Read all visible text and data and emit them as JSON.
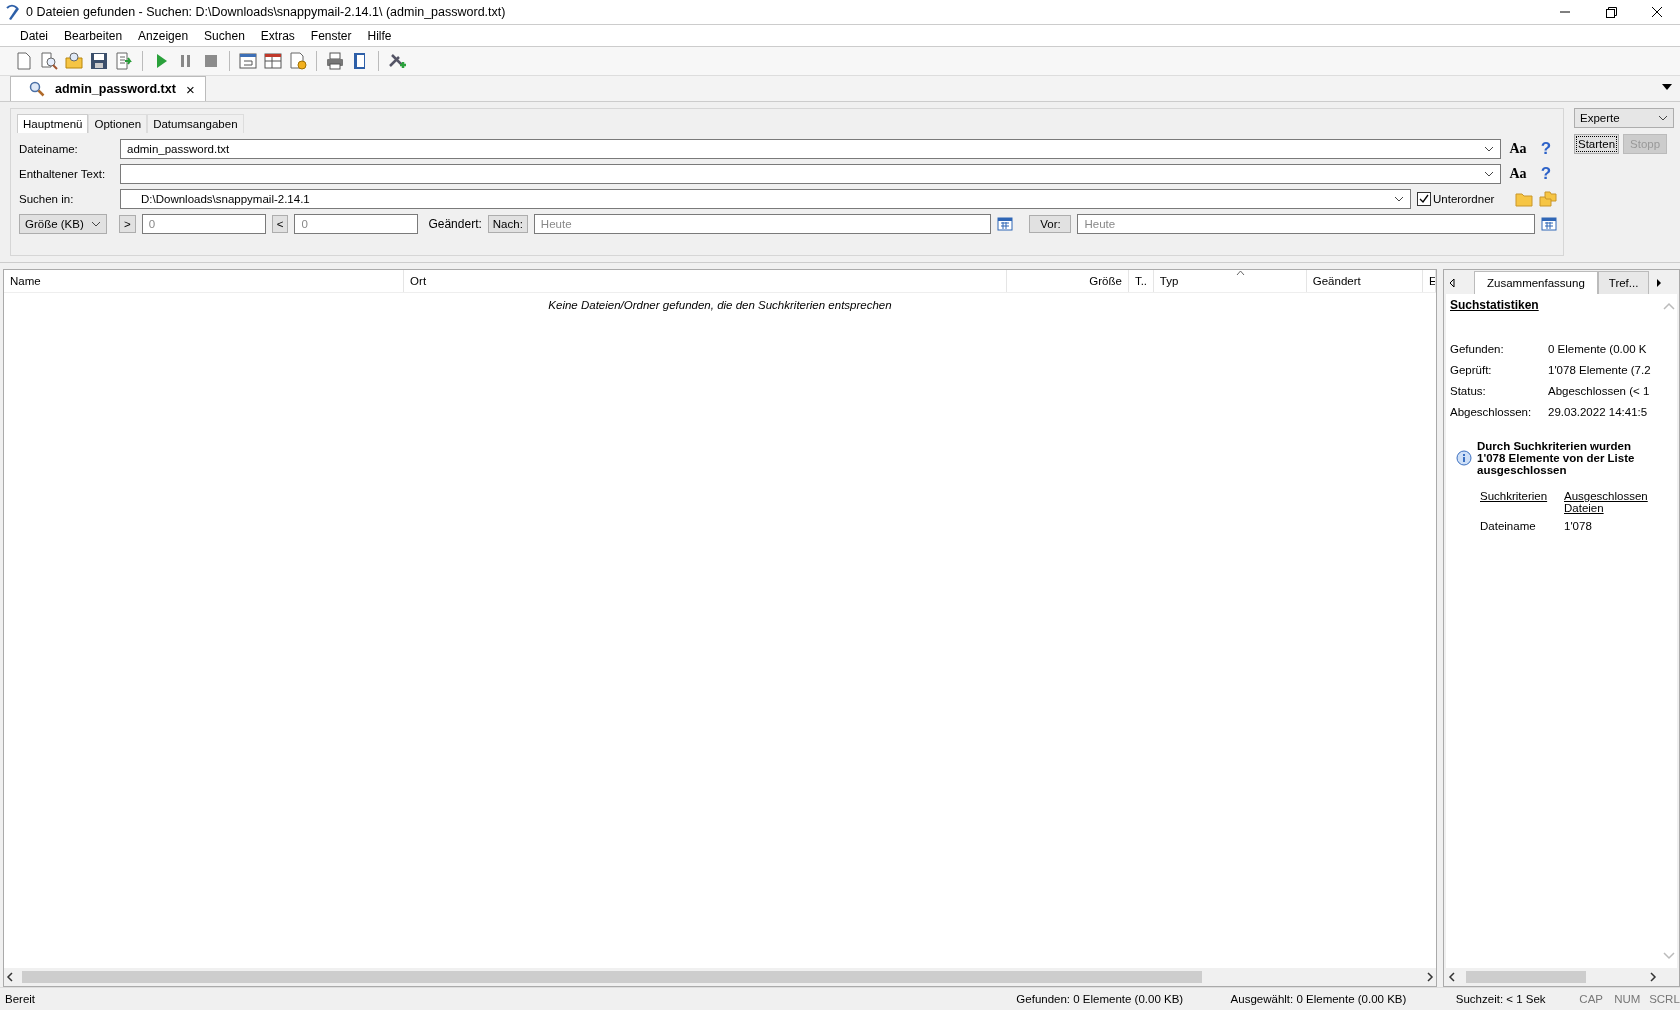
{
  "window": {
    "title": "0 Dateien gefunden - Suchen: D:\\Downloads\\snappymail-2.14.1\\ (admin_password.txt)"
  },
  "menu": [
    {
      "label": "Datei"
    },
    {
      "label": "Bearbeiten"
    },
    {
      "label": "Anzeigen"
    },
    {
      "label": "Suchen"
    },
    {
      "label": "Extras"
    },
    {
      "label": "Fenster"
    },
    {
      "label": "Hilfe"
    }
  ],
  "document_tab": {
    "label": "admin_password.txt",
    "close": "×"
  },
  "search_panel": {
    "tabs": [
      {
        "label": "Hauptmenü",
        "selected": true
      },
      {
        "label": "Optionen",
        "selected": false
      },
      {
        "label": "Datumsangaben",
        "selected": false
      }
    ],
    "fields": [
      {
        "kind": "text",
        "label": "Dateiname:",
        "value": "admin_password.txt",
        "case_button": "Aa",
        "help_button": "?"
      },
      {
        "kind": "text",
        "label": "Enthaltener Text:",
        "case_button": "Aa",
        "help_button": "?"
      },
      {
        "kind": "folder",
        "label": "Suchen in:",
        "value": "D:\\Downloads\\snappymail-2.14.1"
      }
    ],
    "subfolders": {
      "label": "Unterordner",
      "checked": true
    },
    "size_filter": {
      "unit": "Größe (KB)",
      "greater": ">",
      "greater_value": "0",
      "less": "<",
      "less_value": "0"
    },
    "date_filter": {
      "label": "Geändert:",
      "after": "Nach:",
      "after_placeholder": "Heute",
      "before": "Vor:",
      "before_placeholder": "Heute"
    },
    "mode": "Experte",
    "start_button": {
      "label": "Starten",
      "disabled": false
    },
    "stop_button": {
      "label": "Stopp",
      "disabled": true
    }
  },
  "results": {
    "columns": [
      {
        "label": "Name",
        "kind": "text"
      },
      {
        "label": "Ort",
        "kind": "text"
      },
      {
        "label": "Größe",
        "kind": "number"
      },
      {
        "label": "T..",
        "kind": "text"
      },
      {
        "label": "Typ",
        "kind": "text"
      },
      {
        "label": "Geändert",
        "kind": "text"
      },
      {
        "label": "E",
        "kind": "text"
      }
    ],
    "empty_message": "Keine Dateien/Ordner gefunden, die den Suchkriterien entsprechen"
  },
  "summary_panel": {
    "tabs": [
      {
        "label": "Zusammenfassung",
        "selected": true
      },
      {
        "label": "Tref...",
        "selected": false
      }
    ],
    "title": "Suchstatistiken",
    "stats": [
      {
        "label": "Gefunden:",
        "value": "0 Elemente (0.00 K"
      },
      {
        "label": "Geprüft:",
        "value": "1'078 Elemente (7.2"
      },
      {
        "label": "Status:",
        "value": "Abgeschlossen (< 1"
      },
      {
        "label": "Abgeschlossen:",
        "value": "29.03.2022 14:41:5"
      }
    ],
    "info": "Durch Suchkriterien wurden 1'078 Elemente von der Liste ausgeschlossen",
    "exclusions": {
      "columns": [
        "Suchkriterien",
        "Ausgeschlossen Dateien"
      ],
      "rows": [
        [
          "Dateiname",
          "1'078"
        ]
      ]
    }
  },
  "status_bar": {
    "message": "Bereit",
    "found": "Gefunden: 0 Elemente (0.00 KB)",
    "selected": "Ausgewählt: 0 Elemente (0.00 KB)",
    "time": "Suchzeit: < 1 Sek",
    "indicators": [
      {
        "label": "CAP",
        "on": false
      },
      {
        "label": "NUM",
        "on": false
      },
      {
        "label": "SCRL",
        "on": false
      }
    ]
  }
}
